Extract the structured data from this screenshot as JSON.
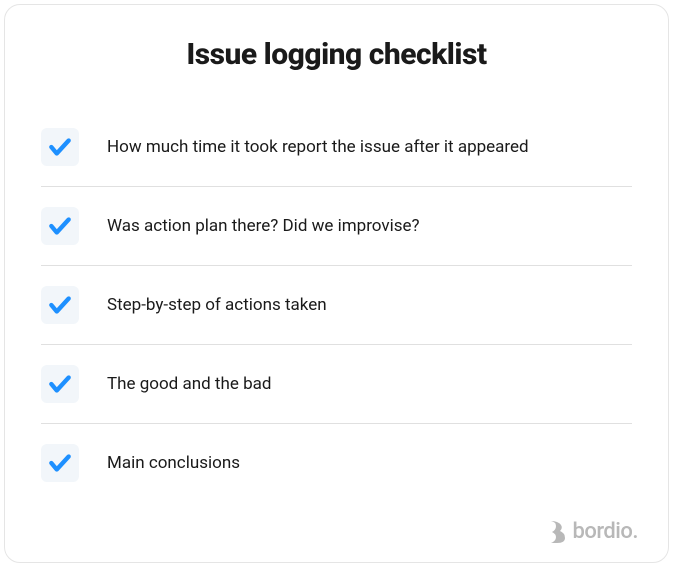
{
  "title": "Issue logging checklist",
  "items": [
    {
      "text": "How much time it took report the issue after it appeared",
      "checked": true
    },
    {
      "text": "Was action plan there? Did we improvise?",
      "checked": true
    },
    {
      "text": "Step-by-step of actions taken",
      "checked": true
    },
    {
      "text": "The good and the bad",
      "checked": true
    },
    {
      "text": "Main conclusions",
      "checked": true
    }
  ],
  "brand": {
    "name": "bordio."
  },
  "colors": {
    "accent": "#1e90ff",
    "checkboxBg": "#f2f6fa",
    "text": "#1a1a1a",
    "border": "#e0e0e0",
    "logo": "#b8b8b8"
  }
}
